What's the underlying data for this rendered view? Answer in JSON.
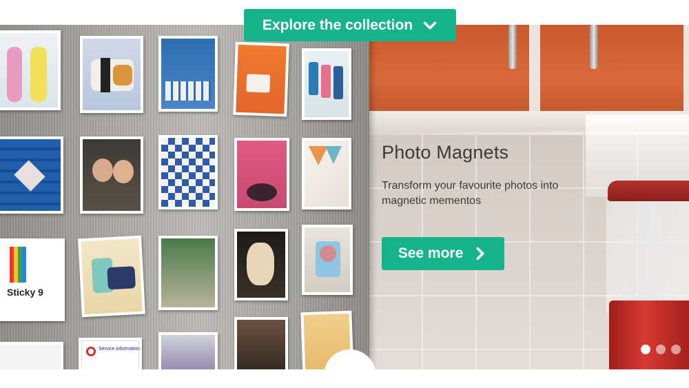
{
  "header": {
    "explore_label": "Explore the collection"
  },
  "slide": {
    "title": "Photo Magnets",
    "description": "Transform your favourite photos into magnetic mementos",
    "cta_label": "See more"
  },
  "carousel": {
    "total_slides": 3,
    "active_index": 0
  },
  "magnet_labels": {
    "sticky9": "Sticky 9",
    "service_info": "Service information"
  },
  "colors": {
    "accent": "#17b38a"
  }
}
